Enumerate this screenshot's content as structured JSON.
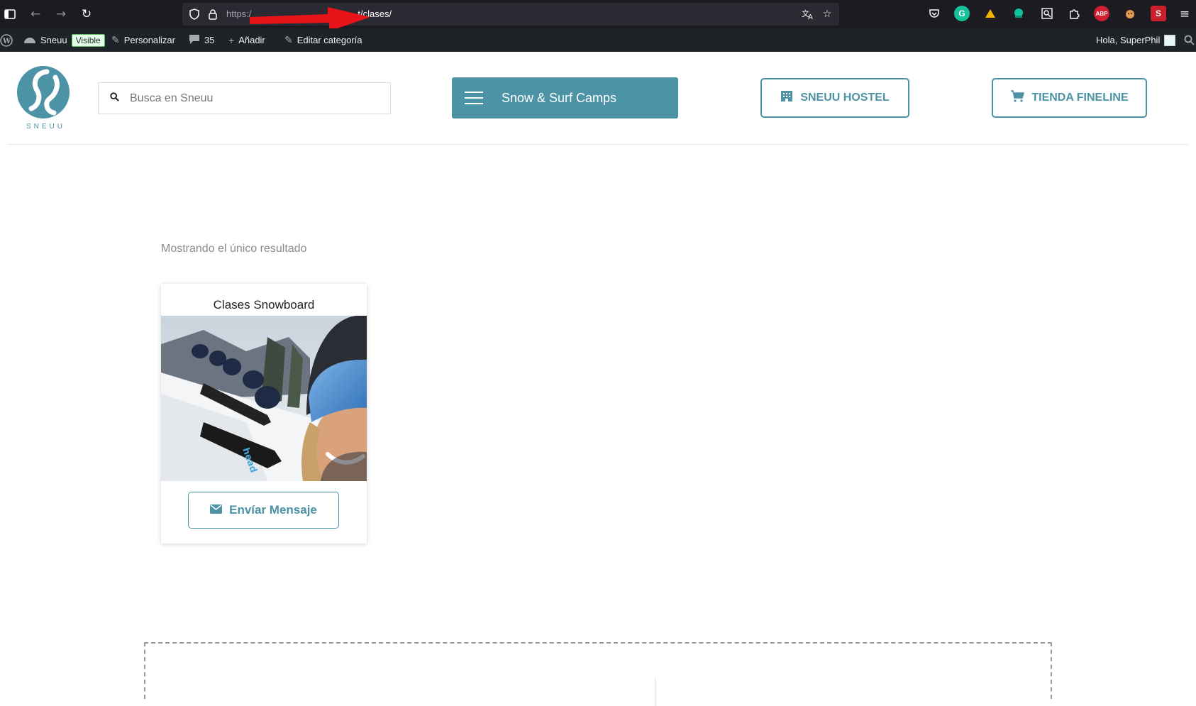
{
  "browser": {
    "url_scheme": "https:/",
    "url_path": "t/clases/"
  },
  "wp_admin_bar": {
    "site_name": "Sneuu",
    "visibility_badge": "Visible",
    "customize_label": "Personalizar",
    "comments_count": "35",
    "add_new_label": "Añadir",
    "edit_category_label": "Editar categoría",
    "greeting": "Hola, SuperPhil"
  },
  "header": {
    "logo_text": "SNEUU",
    "search_placeholder": "Busca en Sneuu",
    "camps_button_label": "Snow & Surf Camps",
    "hostel_button_label": "SNEUU HOSTEL",
    "shop_button_label": "TIENDA FINELINE"
  },
  "main": {
    "result_count": "Mostrando el único resultado",
    "products": [
      {
        "title": "Clases Snowboard",
        "button_label": "Envíar Mensaje"
      }
    ]
  },
  "colors": {
    "brand": "#4b93a5",
    "browser_bg": "#1c1b22",
    "admin_bar_bg": "#1d2327"
  },
  "icons": {
    "sidebar": "sidebar-toggle-icon",
    "back": "back-arrow-icon",
    "forward": "forward-arrow-icon",
    "reload": "reload-icon",
    "shield": "shield-icon",
    "lock": "lock-icon",
    "translate": "translate-icon",
    "bookmark": "star-icon",
    "menu": "hamburger-menu-icon",
    "search": "search-icon",
    "hostel": "building-icon",
    "cart": "cart-icon",
    "envelope": "envelope-icon"
  }
}
